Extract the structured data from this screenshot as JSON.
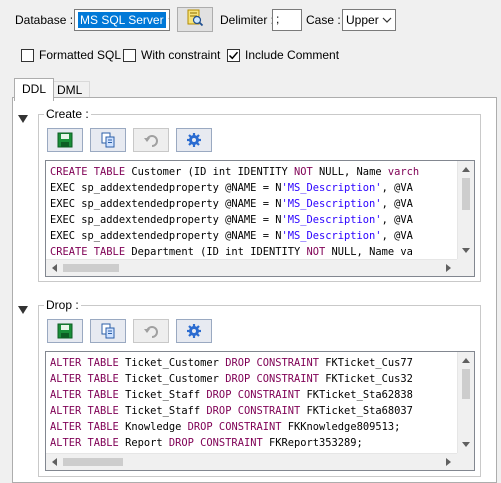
{
  "toolbar": {
    "database_label": "Database :",
    "database_value": "MS SQL Server",
    "delimiter_label": "Delimiter :",
    "delimiter_value": ";",
    "case_label": "Case :",
    "case_value": "Upper"
  },
  "options": {
    "formatted_sql": {
      "label": "Formatted SQL",
      "checked": false
    },
    "with_constraint": {
      "label": "With constraint",
      "checked": false
    },
    "include_comment": {
      "label": "Include Comment",
      "checked": true
    }
  },
  "tabs": [
    {
      "label": "DDL",
      "active": true
    },
    {
      "label": "DML",
      "active": false
    }
  ],
  "create_section": {
    "title": "Create :",
    "buttons": [
      "save-icon",
      "copy-icon",
      "undo-icon",
      "settings-icon"
    ],
    "lines": [
      [
        [
          "kw",
          "CREATE TABLE"
        ],
        [
          "t",
          " Customer (ID int IDENTITY "
        ],
        [
          "kw",
          "NOT"
        ],
        [
          "t",
          " NULL, Name "
        ],
        [
          "kw",
          "varch"
        ]
      ],
      [
        [
          "t",
          "EXEC sp_addextendedproperty @NAME = N"
        ],
        [
          "str",
          "'MS_Description'"
        ],
        [
          "t",
          ", @VA"
        ]
      ],
      [
        [
          "t",
          "EXEC sp_addextendedproperty @NAME = N"
        ],
        [
          "str",
          "'MS_Description'"
        ],
        [
          "t",
          ", @VA"
        ]
      ],
      [
        [
          "t",
          "EXEC sp_addextendedproperty @NAME = N"
        ],
        [
          "str",
          "'MS_Description'"
        ],
        [
          "t",
          ", @VA"
        ]
      ],
      [
        [
          "t",
          "EXEC sp_addextendedproperty @NAME = N"
        ],
        [
          "str",
          "'MS_Description'"
        ],
        [
          "t",
          ", @VA"
        ]
      ],
      [
        [
          "kw",
          "CREATE TABLE"
        ],
        [
          "t",
          " Department (ID int IDENTITY "
        ],
        [
          "kw",
          "NOT"
        ],
        [
          "t",
          " NULL, Name va"
        ]
      ]
    ]
  },
  "drop_section": {
    "title": "Drop :",
    "buttons": [
      "save-icon",
      "copy-icon",
      "undo-icon",
      "settings-icon"
    ],
    "lines": [
      [
        [
          "kw",
          "ALTER TABLE"
        ],
        [
          "t",
          " Ticket_Customer "
        ],
        [
          "kw",
          "DROP CONSTRAINT"
        ],
        [
          "t",
          " FKTicket_Cus77"
        ]
      ],
      [
        [
          "kw",
          "ALTER TABLE"
        ],
        [
          "t",
          " Ticket_Customer "
        ],
        [
          "kw",
          "DROP CONSTRAINT"
        ],
        [
          "t",
          " FKTicket_Cus32"
        ]
      ],
      [
        [
          "kw",
          "ALTER TABLE"
        ],
        [
          "t",
          " Ticket_Staff "
        ],
        [
          "kw",
          "DROP CONSTRAINT"
        ],
        [
          "t",
          " FKTicket_Sta62838"
        ]
      ],
      [
        [
          "kw",
          "ALTER TABLE"
        ],
        [
          "t",
          " Ticket_Staff "
        ],
        [
          "kw",
          "DROP CONSTRAINT"
        ],
        [
          "t",
          " FKTicket_Sta68037"
        ]
      ],
      [
        [
          "kw",
          "ALTER TABLE"
        ],
        [
          "t",
          " Knowledge "
        ],
        [
          "kw",
          "DROP CONSTRAINT"
        ],
        [
          "t",
          " FKKnowledge809513;"
        ]
      ],
      [
        [
          "kw",
          "ALTER TABLE"
        ],
        [
          "t",
          " Report "
        ],
        [
          "kw",
          "DROP CONSTRAINT"
        ],
        [
          "t",
          " FKReport353289;"
        ]
      ]
    ]
  },
  "colors": {
    "keyword": "#7f0055",
    "string": "#2a00ff",
    "selection": "#0078d7"
  }
}
